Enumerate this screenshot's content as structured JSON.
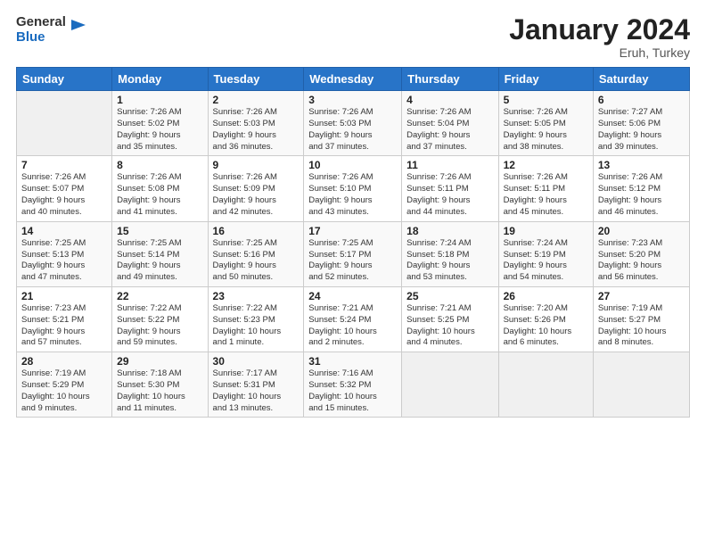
{
  "logo": {
    "line1": "General",
    "line2": "Blue"
  },
  "title": "January 2024",
  "location": "Eruh, Turkey",
  "days_header": [
    "Sunday",
    "Monday",
    "Tuesday",
    "Wednesday",
    "Thursday",
    "Friday",
    "Saturday"
  ],
  "weeks": [
    [
      {
        "num": "",
        "content": ""
      },
      {
        "num": "1",
        "content": "Sunrise: 7:26 AM\nSunset: 5:02 PM\nDaylight: 9 hours\nand 35 minutes."
      },
      {
        "num": "2",
        "content": "Sunrise: 7:26 AM\nSunset: 5:03 PM\nDaylight: 9 hours\nand 36 minutes."
      },
      {
        "num": "3",
        "content": "Sunrise: 7:26 AM\nSunset: 5:03 PM\nDaylight: 9 hours\nand 37 minutes."
      },
      {
        "num": "4",
        "content": "Sunrise: 7:26 AM\nSunset: 5:04 PM\nDaylight: 9 hours\nand 37 minutes."
      },
      {
        "num": "5",
        "content": "Sunrise: 7:26 AM\nSunset: 5:05 PM\nDaylight: 9 hours\nand 38 minutes."
      },
      {
        "num": "6",
        "content": "Sunrise: 7:27 AM\nSunset: 5:06 PM\nDaylight: 9 hours\nand 39 minutes."
      }
    ],
    [
      {
        "num": "7",
        "content": "Sunrise: 7:26 AM\nSunset: 5:07 PM\nDaylight: 9 hours\nand 40 minutes."
      },
      {
        "num": "8",
        "content": "Sunrise: 7:26 AM\nSunset: 5:08 PM\nDaylight: 9 hours\nand 41 minutes."
      },
      {
        "num": "9",
        "content": "Sunrise: 7:26 AM\nSunset: 5:09 PM\nDaylight: 9 hours\nand 42 minutes."
      },
      {
        "num": "10",
        "content": "Sunrise: 7:26 AM\nSunset: 5:10 PM\nDaylight: 9 hours\nand 43 minutes."
      },
      {
        "num": "11",
        "content": "Sunrise: 7:26 AM\nSunset: 5:11 PM\nDaylight: 9 hours\nand 44 minutes."
      },
      {
        "num": "12",
        "content": "Sunrise: 7:26 AM\nSunset: 5:11 PM\nDaylight: 9 hours\nand 45 minutes."
      },
      {
        "num": "13",
        "content": "Sunrise: 7:26 AM\nSunset: 5:12 PM\nDaylight: 9 hours\nand 46 minutes."
      }
    ],
    [
      {
        "num": "14",
        "content": "Sunrise: 7:25 AM\nSunset: 5:13 PM\nDaylight: 9 hours\nand 47 minutes."
      },
      {
        "num": "15",
        "content": "Sunrise: 7:25 AM\nSunset: 5:14 PM\nDaylight: 9 hours\nand 49 minutes."
      },
      {
        "num": "16",
        "content": "Sunrise: 7:25 AM\nSunset: 5:16 PM\nDaylight: 9 hours\nand 50 minutes."
      },
      {
        "num": "17",
        "content": "Sunrise: 7:25 AM\nSunset: 5:17 PM\nDaylight: 9 hours\nand 52 minutes."
      },
      {
        "num": "18",
        "content": "Sunrise: 7:24 AM\nSunset: 5:18 PM\nDaylight: 9 hours\nand 53 minutes."
      },
      {
        "num": "19",
        "content": "Sunrise: 7:24 AM\nSunset: 5:19 PM\nDaylight: 9 hours\nand 54 minutes."
      },
      {
        "num": "20",
        "content": "Sunrise: 7:23 AM\nSunset: 5:20 PM\nDaylight: 9 hours\nand 56 minutes."
      }
    ],
    [
      {
        "num": "21",
        "content": "Sunrise: 7:23 AM\nSunset: 5:21 PM\nDaylight: 9 hours\nand 57 minutes."
      },
      {
        "num": "22",
        "content": "Sunrise: 7:22 AM\nSunset: 5:22 PM\nDaylight: 9 hours\nand 59 minutes."
      },
      {
        "num": "23",
        "content": "Sunrise: 7:22 AM\nSunset: 5:23 PM\nDaylight: 10 hours\nand 1 minute."
      },
      {
        "num": "24",
        "content": "Sunrise: 7:21 AM\nSunset: 5:24 PM\nDaylight: 10 hours\nand 2 minutes."
      },
      {
        "num": "25",
        "content": "Sunrise: 7:21 AM\nSunset: 5:25 PM\nDaylight: 10 hours\nand 4 minutes."
      },
      {
        "num": "26",
        "content": "Sunrise: 7:20 AM\nSunset: 5:26 PM\nDaylight: 10 hours\nand 6 minutes."
      },
      {
        "num": "27",
        "content": "Sunrise: 7:19 AM\nSunset: 5:27 PM\nDaylight: 10 hours\nand 8 minutes."
      }
    ],
    [
      {
        "num": "28",
        "content": "Sunrise: 7:19 AM\nSunset: 5:29 PM\nDaylight: 10 hours\nand 9 minutes."
      },
      {
        "num": "29",
        "content": "Sunrise: 7:18 AM\nSunset: 5:30 PM\nDaylight: 10 hours\nand 11 minutes."
      },
      {
        "num": "30",
        "content": "Sunrise: 7:17 AM\nSunset: 5:31 PM\nDaylight: 10 hours\nand 13 minutes."
      },
      {
        "num": "31",
        "content": "Sunrise: 7:16 AM\nSunset: 5:32 PM\nDaylight: 10 hours\nand 15 minutes."
      },
      {
        "num": "",
        "content": ""
      },
      {
        "num": "",
        "content": ""
      },
      {
        "num": "",
        "content": ""
      }
    ]
  ]
}
